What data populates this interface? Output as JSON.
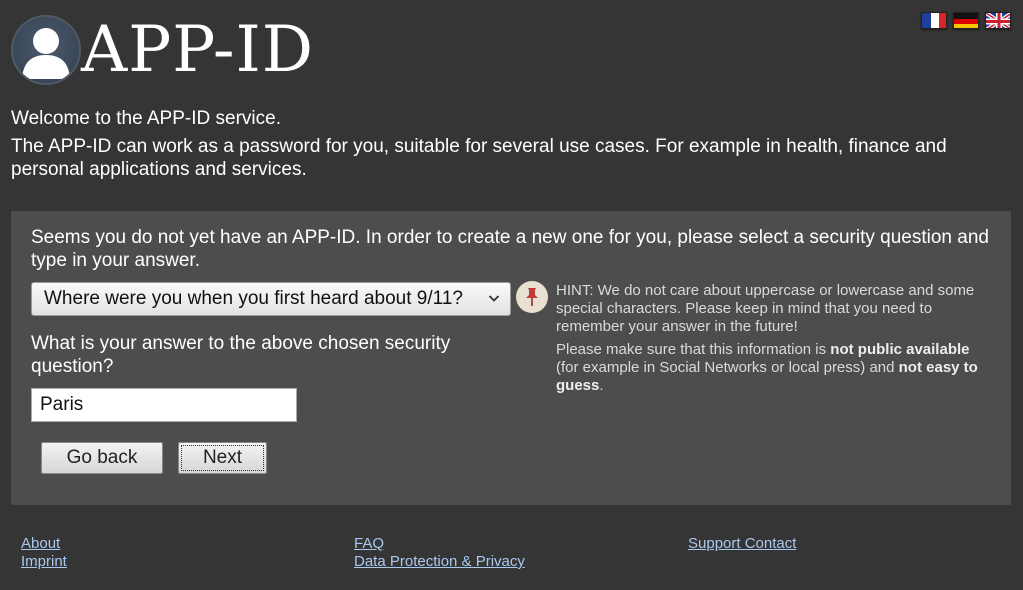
{
  "header": {
    "logo_text": "APP-ID",
    "flags": [
      "french-flag",
      "german-flag",
      "uk-flag"
    ]
  },
  "intro": {
    "welcome": "Welcome to the APP-ID service.",
    "description": "The APP-ID can work as a password for you, suitable for several use cases. For example in health, finance and personal applications and services."
  },
  "panel": {
    "instructions": "Seems you do not yet have an APP-ID. In order to create a new one for you, please select a security question and type in your answer.",
    "security_question_selected": "Where were you when you first heard about 9/11?",
    "answer_prompt": "What is your answer to the above chosen security question?",
    "answer_value": "Paris",
    "back_label": "Go back",
    "next_label": "Next",
    "hint1": "HINT: We do not care about uppercase or lowercase and some special characters. Please keep in mind that you need to remember your answer in the future!",
    "hint2_a": "Please make sure that this information is ",
    "hint2_b": "not public available",
    "hint2_c": " (for example in Social Networks or local press) and ",
    "hint2_d": "not easy to guess",
    "hint2_e": "."
  },
  "footer": {
    "about": "About",
    "imprint": "Imprint",
    "faq": "FAQ",
    "privacy": "Data Protection & Privacy",
    "support": "Support Contact"
  },
  "colors": {
    "background": "#353535",
    "panel": "#4d4d4d",
    "link": "#a9c8ee"
  }
}
